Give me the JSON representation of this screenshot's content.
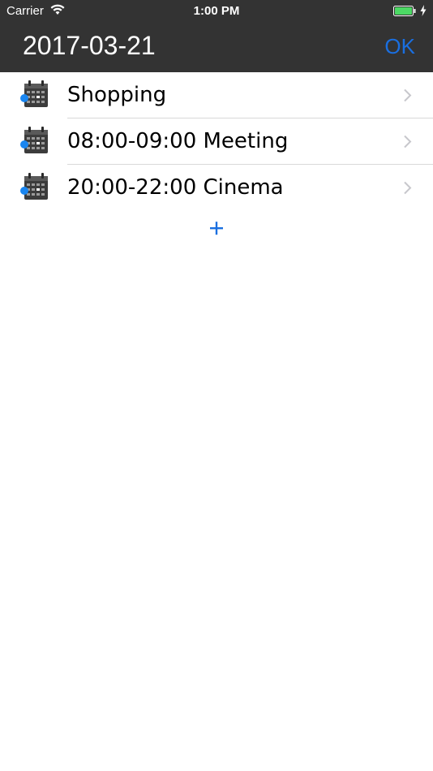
{
  "status_bar": {
    "carrier": "Carrier",
    "time": "1:00 PM",
    "battery_color": "#4cd964"
  },
  "nav": {
    "title": "2017-03-21",
    "ok_label": "OK",
    "accent_color": "#1a6fe0",
    "background": "#333333"
  },
  "events": [
    {
      "label": "Shopping",
      "icon": "calendar-icon"
    },
    {
      "label": "08:00-09:00 Meeting",
      "icon": "calendar-icon"
    },
    {
      "label": "20:00-22:00 Cinema",
      "icon": "calendar-icon"
    }
  ],
  "add_button": {
    "icon": "plus-icon"
  }
}
